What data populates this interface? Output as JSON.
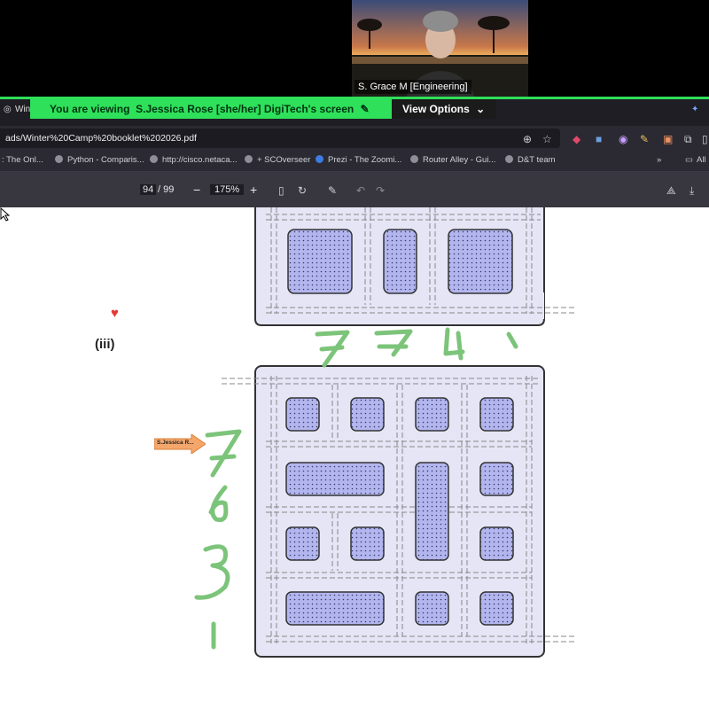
{
  "webcam": {
    "participant_name": "S. Grace M [Engineering]"
  },
  "share_banner": {
    "viewing_prefix": "You are viewing",
    "presenter": "S.Jessica Rose [she/her] DigiTech's screen",
    "options_label": "View Options"
  },
  "browser": {
    "tab_fragment": "Wint",
    "url": "ads/Winter%20Camp%20booklet%202026.pdf",
    "bookmarks": [
      ": The Onl...",
      "Python - Comparis...",
      "http://cisco.netaca...",
      "+ SCOverseer",
      "Prezi - The Zoomi...",
      "Router Alley - Gui...",
      "D&T team"
    ],
    "bookmarks_more": "All"
  },
  "pdf_toolbar": {
    "page_current": "94",
    "page_total": "/ 99",
    "zoom": "175%",
    "zoom_out": "−",
    "zoom_in": "+"
  },
  "document": {
    "question_label": "(iii)",
    "annotator_tag": "S.Jessica R...",
    "handwriting_top": "7 7 4 1",
    "handwriting_left": "7 6 3 1"
  },
  "colors": {
    "share_green": "#2ee05a",
    "panel_fill": "#e6e5f6",
    "block_fill": "#b3b6ee",
    "ink_green": "#7cc47a"
  }
}
